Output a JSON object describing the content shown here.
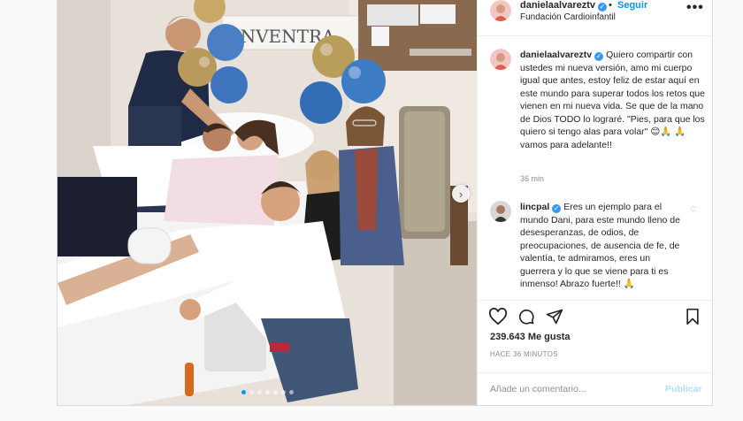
{
  "post": {
    "username": "danielaalvareztv",
    "follow_label": "Seguir",
    "separator": "•",
    "location": "Fundación Cardioinfantil",
    "more_label": "•••",
    "photo": {
      "banner_text": "ENVENTRA",
      "slide_count": 7,
      "active_slide": 1
    }
  },
  "comments": [
    {
      "username": "danielaalvareztv",
      "text": "Quiero compartir con ustedes mi nueva versión, amo mi cuerpo igual que antes, estoy feliz de estar aquí en este mundo para superar todos los retos que vienen en mi nueva vida. Se que de la mano de Dios TODO lo lograré. \"Pies, para que los quiero si tengo alas para volar\" 😊🙏 🙏 vamos para adelante!!",
      "time": "36 min"
    },
    {
      "username": "lincpal",
      "text": "Eres un ejemplo para el mundo Dani, para este mundo lleno de desesperanzas, de odios, de preocupaciones, de ausencia de fe, de valentía, te admiramos, eres un guerrera y lo que se viene para ti es inmenso! Abrazo fuerte!! 🙏"
    }
  ],
  "actions": {
    "likes": "239.643 Me gusta",
    "posted_ago": "HACE 36 MINUTOS",
    "comment_placeholder": "Añade un comentario...",
    "publish_label": "Publicar"
  },
  "colors": {
    "accent": "#0095f6",
    "verified": "#3897f0",
    "muted": "#8e8e8e",
    "border": "#dbdbdb"
  }
}
